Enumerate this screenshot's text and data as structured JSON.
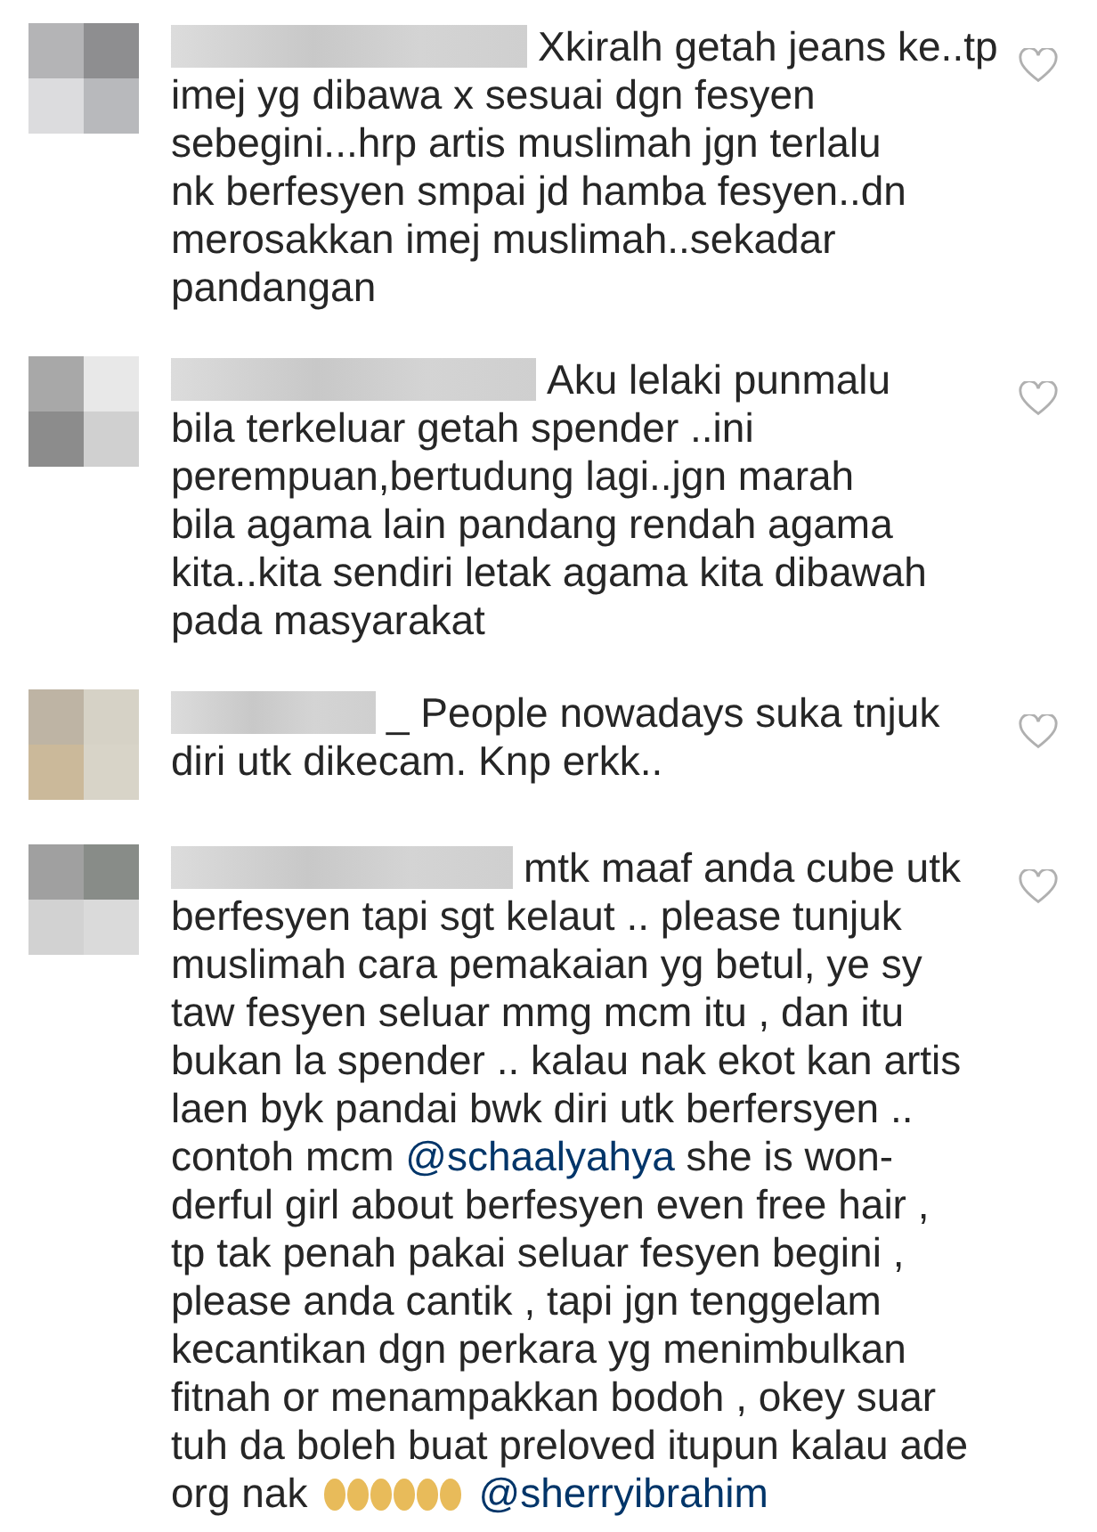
{
  "comments": [
    {
      "liked": false,
      "lines": [
        [
          {
            "kind": "text",
            "text": "Xkiralh getah jeans ke..tp"
          }
        ],
        [
          {
            "kind": "text",
            "text": "imej yg dibawa x sesuai dgn fesyen"
          }
        ],
        [
          {
            "kind": "text",
            "text": "sebegini...hrp artis muslimah jgn terlalu"
          }
        ],
        [
          {
            "kind": "text",
            "text": "nk berfesyen smpai jd hamba fesyen..dn"
          }
        ],
        [
          {
            "kind": "text",
            "text": "merosakkan imej muslimah..sekadar"
          }
        ],
        [
          {
            "kind": "text",
            "text": "pandangan"
          }
        ]
      ]
    },
    {
      "liked": false,
      "lines": [
        [
          {
            "kind": "text",
            "text": "Aku lelaki punmalu"
          }
        ],
        [
          {
            "kind": "text",
            "text": "bila terkeluar getah spender ..ini"
          }
        ],
        [
          {
            "kind": "text",
            "text": "perempuan,bertudung lagi..jgn marah"
          }
        ],
        [
          {
            "kind": "text",
            "text": "bila agama lain pandang rendah agama"
          }
        ],
        [
          {
            "kind": "text",
            "text": "kita..kita sendiri letak agama kita dibawah"
          }
        ],
        [
          {
            "kind": "text",
            "text": "pada masyarakat"
          }
        ]
      ]
    },
    {
      "liked": false,
      "lines": [
        [
          {
            "kind": "text",
            "text": "_ People nowadays suka tnjuk"
          }
        ],
        [
          {
            "kind": "text",
            "text": "diri utk dikecam. Knp erkk.."
          }
        ]
      ]
    },
    {
      "liked": false,
      "lines": [
        [
          {
            "kind": "text",
            "text": "mtk maaf anda cube utk"
          }
        ],
        [
          {
            "kind": "text",
            "text": "berfesyen tapi sgt kelaut .. please tunjuk"
          }
        ],
        [
          {
            "kind": "text",
            "text": "muslimah cara pemakaian yg betul, ye sy"
          }
        ],
        [
          {
            "kind": "text",
            "text": "taw fesyen seluar mmg mcm itu , dan itu"
          }
        ],
        [
          {
            "kind": "text",
            "text": "bukan la spender .. kalau nak ekot kan artis"
          }
        ],
        [
          {
            "kind": "text",
            "text": "laen byk pandai bwk diri utk berfersyen .."
          }
        ],
        [
          {
            "kind": "text",
            "text": "contoh mcm "
          },
          {
            "kind": "mention",
            "text": "@schaalyahya"
          },
          {
            "kind": "text",
            "text": " she is won-"
          }
        ],
        [
          {
            "kind": "text",
            "text": "derful girl about berfesyen even free hair ,"
          }
        ],
        [
          {
            "kind": "text",
            "text": "tp tak penah pakai seluar fesyen begini ,"
          }
        ],
        [
          {
            "kind": "text",
            "text": "please anda cantik , tapi jgn tenggelam"
          }
        ],
        [
          {
            "kind": "text",
            "text": "kecantikan dgn perkara yg menimbulkan"
          }
        ],
        [
          {
            "kind": "text",
            "text": "fitnah or menampakkan bodoh , okey suar"
          }
        ],
        [
          {
            "kind": "text",
            "text": "tuh da boleh buat preloved itupun kalau ade"
          }
        ],
        [
          {
            "kind": "text",
            "text": "org nak"
          },
          {
            "kind": "emoji"
          },
          {
            "kind": "mention",
            "text": "@sherryibrahim"
          }
        ]
      ]
    }
  ]
}
